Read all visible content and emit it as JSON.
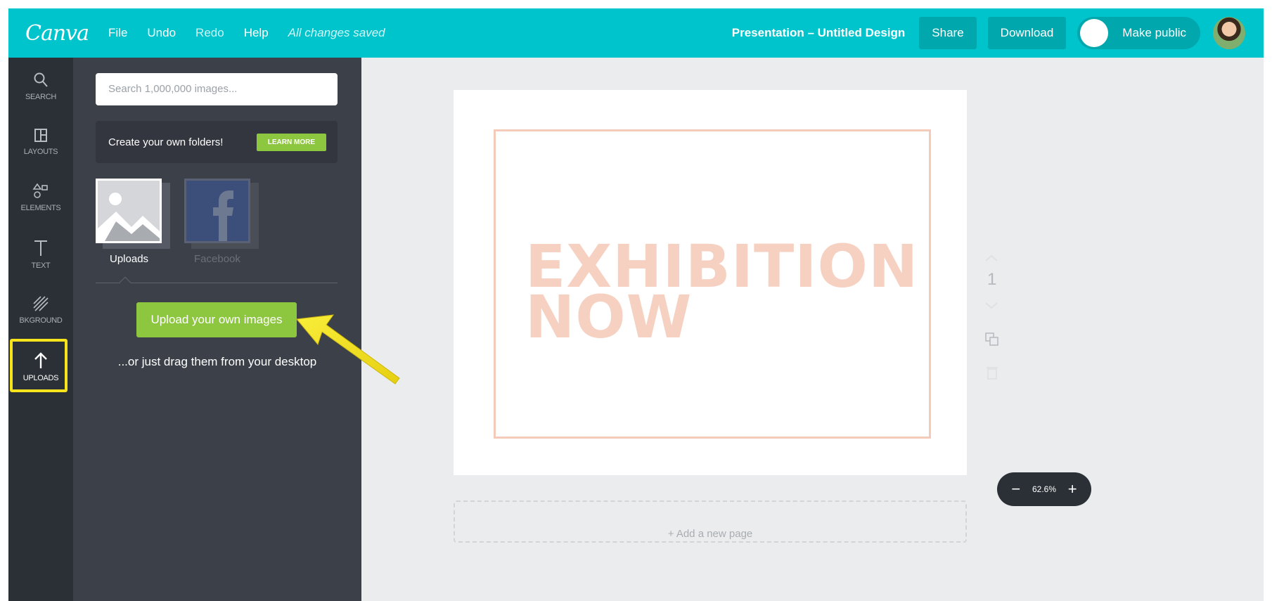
{
  "topbar": {
    "logo": "Canva",
    "menu": [
      "File",
      "Undo",
      "Redo",
      "Help"
    ],
    "saved_status": "All changes saved",
    "doc_title": "Presentation – Untitled Design",
    "share": "Share",
    "download": "Download",
    "make_public": "Make public"
  },
  "rail": {
    "items": [
      {
        "label": "SEARCH",
        "icon": "search-icon"
      },
      {
        "label": "LAYOUTS",
        "icon": "layouts-icon"
      },
      {
        "label": "ELEMENTS",
        "icon": "elements-icon"
      },
      {
        "label": "TEXT",
        "icon": "text-icon"
      },
      {
        "label": "BKGROUND",
        "icon": "background-icon"
      },
      {
        "label": "UPLOADS",
        "icon": "upload-arrow-icon"
      }
    ],
    "active": "UPLOADS"
  },
  "panel": {
    "search_placeholder": "Search 1,000,000 images...",
    "promo_text": "Create your own folders!",
    "learn_more": "LEARN MORE",
    "sources": [
      {
        "label": "Uploads",
        "active": true
      },
      {
        "label": "Facebook",
        "active": false
      }
    ],
    "upload_button": "Upload your own images",
    "drag_hint": "...or just drag them from your desktop"
  },
  "canvas": {
    "headline_line1": "EXHIBITION",
    "headline_line2": "NOW",
    "page_number": "1",
    "add_page": "+ Add a new page"
  },
  "zoom": {
    "minus": "−",
    "value": "62.6%",
    "plus": "+"
  },
  "colors": {
    "topbar": "#00c4cc",
    "accent_green": "#8dc63f",
    "highlight_yellow": "#f7e31b",
    "headline": "#f6d0c1"
  }
}
